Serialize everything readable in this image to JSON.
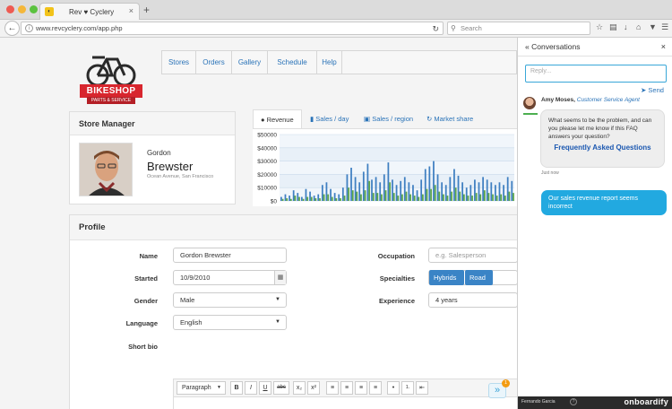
{
  "browser": {
    "tab_title": "Rev ♥ Cyclery",
    "tab_favicon": "bike-favicon",
    "url": "www.revcyclery.com/app.php",
    "search_placeholder": "Search",
    "new_tab": "+",
    "tab_close": "×"
  },
  "logo": {
    "brand": "BIKESHOP",
    "tagline": "PARTS & SERVICE",
    "brand_color": "#d8262e"
  },
  "menu": {
    "items": [
      "Stores",
      "Orders",
      "Gallery",
      "Schedule",
      "Help"
    ]
  },
  "store_manager": {
    "title": "Store Manager",
    "first_name": "Gordon",
    "last_name": "Brewster",
    "address": "Ocean Avenue, San Francisco"
  },
  "chart_tabs": [
    {
      "label": "Revenue",
      "icon": "revenue-icon",
      "active": true
    },
    {
      "label": "Sales / day",
      "icon": "bar-chart-icon",
      "active": false
    },
    {
      "label": "Sales / region",
      "icon": "image-icon",
      "active": false
    },
    {
      "label": "Market share",
      "icon": "refresh-icon",
      "active": false
    }
  ],
  "chart_data": {
    "type": "bar",
    "ylim": [
      0,
      50000
    ],
    "yticks": [
      "$50000",
      "$40000",
      "$30000",
      "$20000",
      "$10000",
      "$0"
    ],
    "series_colors": [
      "#3f7fc1",
      "#5aa54a"
    ],
    "series": [
      {
        "values": [
          3000,
          5000,
          4000,
          8000,
          6000,
          3000,
          9000,
          7000,
          4000,
          5000,
          12000,
          14000,
          9000,
          6000,
          5000,
          10000,
          20000,
          25000,
          18000,
          14000,
          22000,
          28000,
          16000,
          18000,
          14000,
          20000,
          29000,
          16000,
          12000,
          15000,
          18000,
          14000,
          12000,
          8000,
          16000,
          24000,
          26000,
          30000,
          20000,
          14000,
          12000,
          18000,
          24000,
          19000,
          14000,
          10000,
          12000,
          16000,
          14000,
          18000,
          16000,
          14000,
          12000,
          14000,
          12000,
          18000,
          15000
        ]
      },
      {
        "values": [
          1500,
          2000,
          1500,
          4000,
          3000,
          1500,
          3000,
          3000,
          2000,
          2000,
          5000,
          5000,
          3000,
          2000,
          2000,
          4000,
          10000,
          8000,
          7000,
          5000,
          8000,
          15000,
          6000,
          6000,
          5000,
          8000,
          14000,
          6000,
          4000,
          5000,
          7000,
          5000,
          4000,
          3000,
          5000,
          9000,
          9000,
          12000,
          7000,
          5000,
          4000,
          7000,
          10000,
          7000,
          5000,
          4000,
          4000,
          6000,
          5000,
          8000,
          6000,
          5000,
          4000,
          5000,
          4000,
          7000,
          6000
        ]
      }
    ]
  },
  "profile": {
    "title": "Profile",
    "labels": {
      "name": "Name",
      "started": "Started",
      "gender": "Gender",
      "language": "Language",
      "short_bio": "Short bio",
      "occupation": "Occupation",
      "specialties": "Specialties",
      "experience": "Experience"
    },
    "name_value": "Gordon Brewster",
    "started_value": "10/9/2010",
    "gender_value": "Male",
    "language_value": "English",
    "occupation_placeholder": "e.g. Salesperson",
    "specialties": [
      "Hybrids",
      "Road"
    ],
    "experience_value": "4 years",
    "editor": {
      "format": "Paragraph",
      "buttons": [
        "B",
        "I",
        "U",
        "abc",
        "x₂",
        "x²",
        "≡",
        "≡",
        "≡",
        "≡",
        "•",
        "1.",
        "⇤"
      ]
    }
  },
  "expand": {
    "label": "»",
    "badge": "1"
  },
  "conversations": {
    "title": "Conversations",
    "collapse": "«",
    "close": "×",
    "reply_placeholder": "Reply...",
    "send_label": "Send",
    "agent_name": "Amy Moses,",
    "agent_role": "Customer Service Agent",
    "agent_message": "What seems to be the problem, and can you please let me know if this FAQ answers your question?",
    "faq_link": "Frequently Asked Questions",
    "timestamp": "Just now",
    "user_message": "Our sales revenue report seems incorrect",
    "footer_user": "Fernando Garcia",
    "footer_help": "?",
    "brand": "onboardify",
    "accent_color": "#22a9e0"
  }
}
